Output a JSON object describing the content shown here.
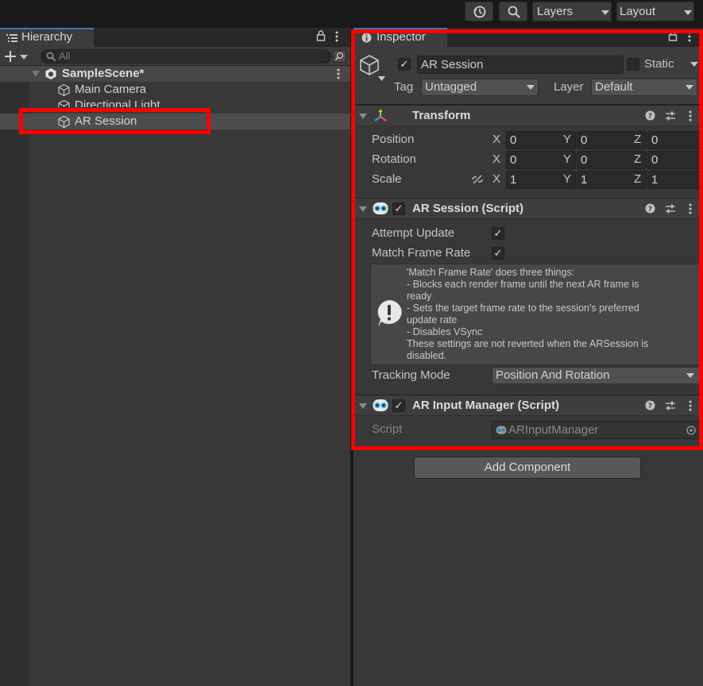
{
  "toolbar": {
    "history_icon": "history-icon",
    "search_icon": "search-icon",
    "layers_label": "Layers",
    "layout_label": "Layout"
  },
  "hierarchy": {
    "tab_label": "Hierarchy",
    "search_placeholder": "All",
    "scene": "SampleScene*",
    "items": [
      {
        "label": "Main Camera"
      },
      {
        "label": "Directional Light"
      },
      {
        "label": "AR Session",
        "selected": true
      }
    ]
  },
  "inspector": {
    "tab_label": "Inspector",
    "object_name": "AR Session",
    "active": true,
    "static_label": "Static",
    "tag_label": "Tag",
    "tag_value": "Untagged",
    "layer_label": "Layer",
    "layer_value": "Default",
    "transform": {
      "title": "Transform",
      "rows": [
        {
          "label": "Position",
          "x": "0",
          "y": "0",
          "z": "0"
        },
        {
          "label": "Rotation",
          "x": "0",
          "y": "0",
          "z": "0"
        },
        {
          "label": "Scale",
          "x": "1",
          "y": "1",
          "z": "1"
        }
      ],
      "axis_x": "X",
      "axis_y": "Y",
      "axis_z": "Z"
    },
    "ar_session": {
      "title": "AR Session (Script)",
      "attempt_update_label": "Attempt Update",
      "attempt_update": true,
      "match_frame_rate_label": "Match Frame Rate",
      "match_frame_rate": true,
      "help_lines": [
        "'Match Frame Rate' does three things:",
        "- Blocks each render frame until the next AR frame is",
        "ready",
        "- Sets the target frame rate to the session's preferred",
        "update rate",
        "- Disables VSync",
        "These settings are not reverted when the ARSession is",
        "disabled."
      ],
      "tracking_mode_label": "Tracking Mode",
      "tracking_mode_value": "Position And Rotation"
    },
    "ar_input_manager": {
      "title": "AR Input Manager (Script)",
      "script_label": "Script",
      "script_value": "ARInputManager"
    },
    "add_component_label": "Add Component"
  },
  "colors": {
    "highlight": "#ff0000",
    "tab_accent": "#3a79bb"
  }
}
